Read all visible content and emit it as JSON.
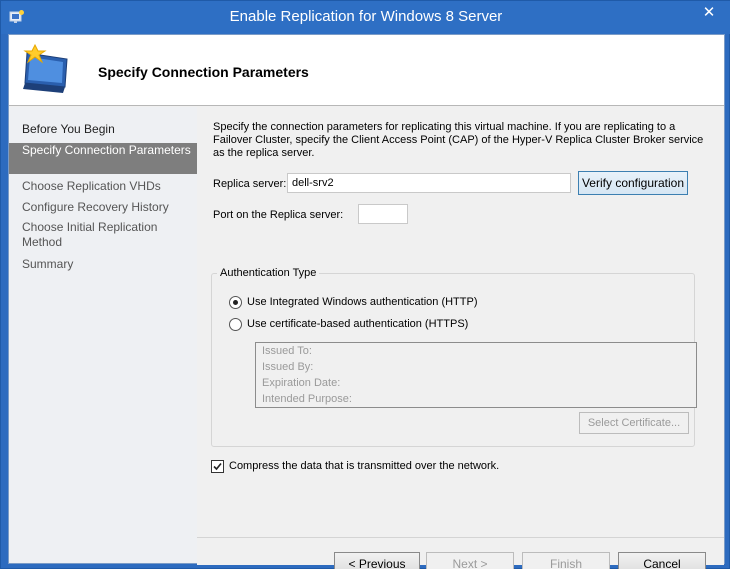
{
  "window": {
    "title": "Enable Replication for Windows 8 Server",
    "close_glyph": "✕"
  },
  "header": {
    "title": "Specify Connection Parameters",
    "icon": "wizard-monitor-icon"
  },
  "nav": {
    "items": [
      {
        "label": "Before You Begin",
        "active": false
      },
      {
        "label": "Specify Connection Parameters",
        "active": true
      },
      {
        "label": "Choose Replication VHDs",
        "active": false
      },
      {
        "label": "Configure Recovery History",
        "active": false
      },
      {
        "label": "Choose Initial Replication Method",
        "active": false
      },
      {
        "label": "Summary",
        "active": false
      }
    ]
  },
  "content": {
    "intro": "Specify the connection parameters for replicating this virtual machine. If you are replicating to a Failover Cluster, specify the Client Access Point (CAP) of the Hyper-V Replica Cluster Broker service as the replica server.",
    "replica_server_label": "Replica server:",
    "replica_server_value": "dell-srv2",
    "verify_button": "Verify configuration",
    "port_label": "Port on the Replica server:",
    "port_value": "",
    "auth": {
      "title": "Authentication Type",
      "option_http": "Use Integrated Windows authentication (HTTP)",
      "option_https": "Use certificate-based authentication (HTTPS)",
      "selected": "http",
      "cert_fields": {
        "issued_to": "Issued To:",
        "issued_by": "Issued By:",
        "expiration": "Expiration Date:",
        "purpose": "Intended Purpose:"
      },
      "select_cert_button": "Select Certificate..."
    },
    "compress_label": "Compress the data that is transmitted over the network.",
    "compress_checked": true
  },
  "footer": {
    "previous": "< Previous",
    "next": "Next >",
    "finish": "Finish",
    "cancel": "Cancel"
  },
  "colors": {
    "titlebar": "#2e6fc4",
    "nav_active": "#7e7e7e"
  }
}
